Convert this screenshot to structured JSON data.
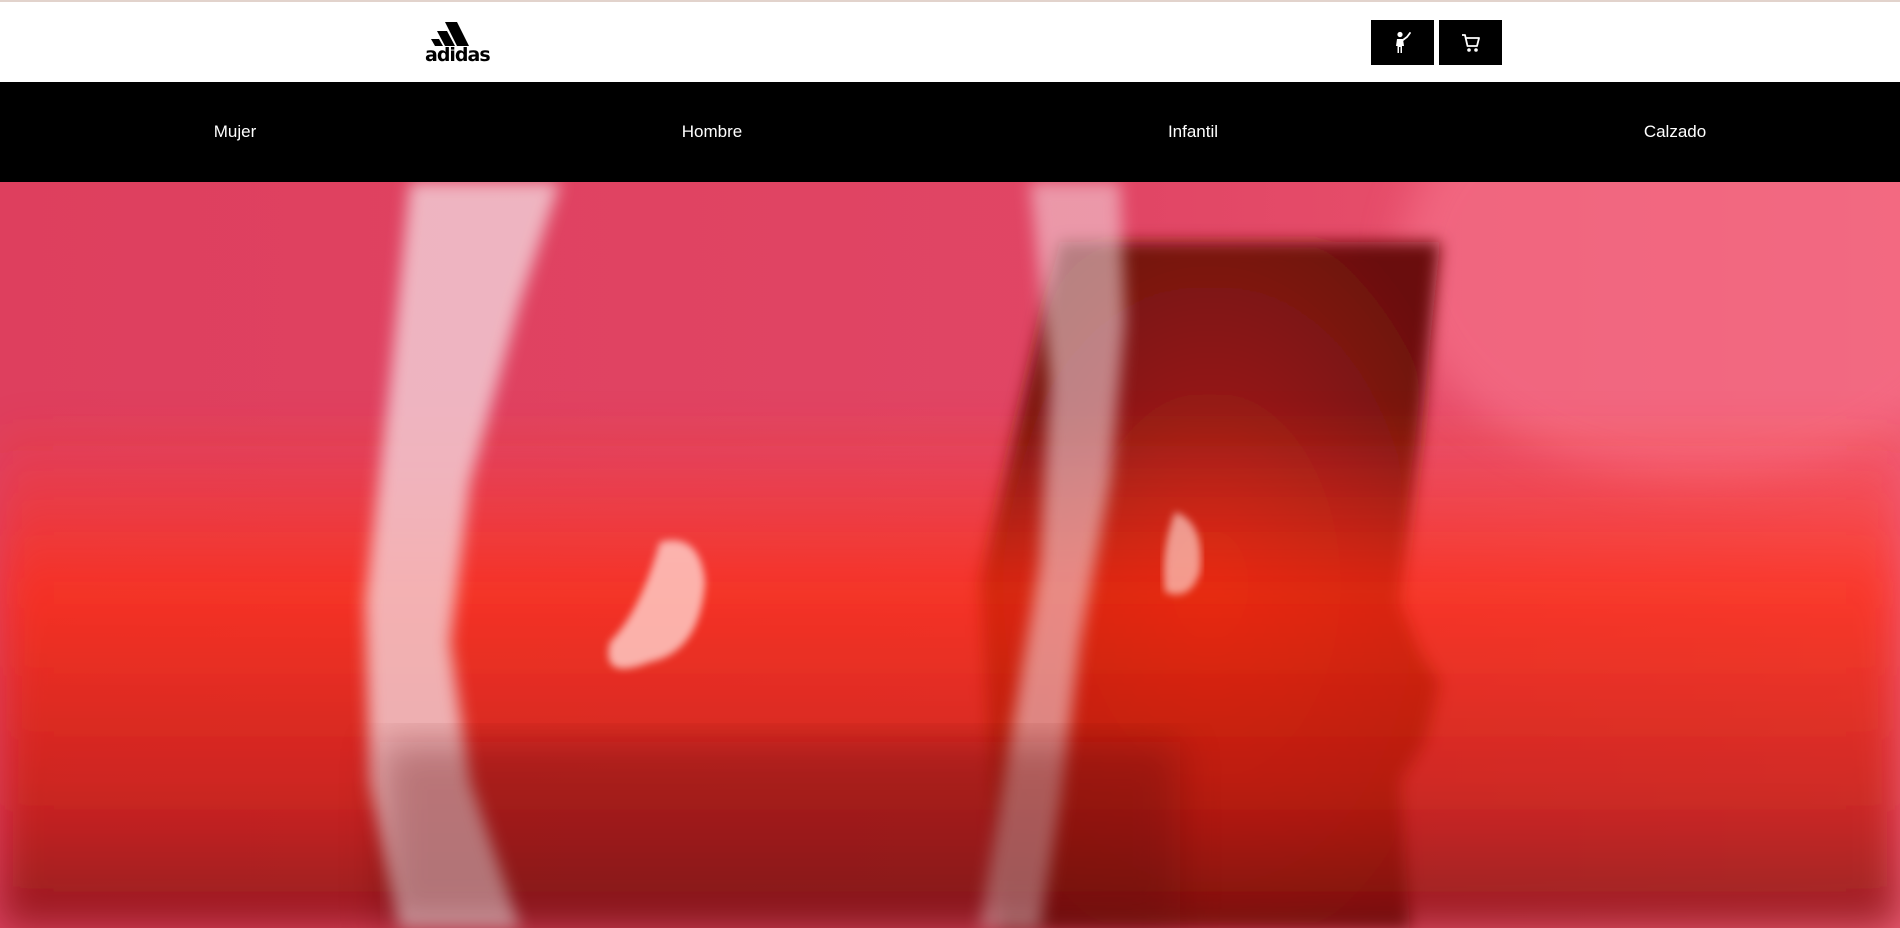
{
  "header": {
    "logo": {
      "text": "adidas",
      "icon": "adidas-logo"
    },
    "account_button": {
      "icon": "person-icon"
    },
    "cart_button": {
      "icon": "cart-icon"
    }
  },
  "nav": {
    "items": [
      {
        "label": "Mujer"
      },
      {
        "label": "Hombre"
      },
      {
        "label": "Infantil"
      },
      {
        "label": "Calzado"
      }
    ]
  },
  "hero": {
    "image": "hero-image",
    "colors": {
      "background": "#dd4463",
      "red_band": "#ff2a14",
      "highlight": "#f4dbe1",
      "shadow": "#6e1012"
    }
  },
  "colors": {
    "header_bg": "#ffffff",
    "nav_bg": "#000000",
    "nav_text": "#ffffff",
    "button_bg": "#000000"
  }
}
